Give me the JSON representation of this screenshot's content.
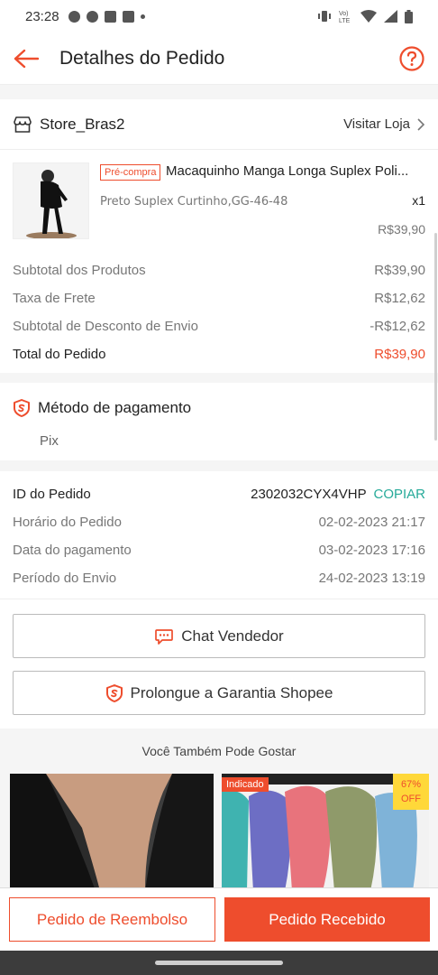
{
  "status": {
    "time": "23:28"
  },
  "header": {
    "title": "Detalhes do Pedido"
  },
  "store": {
    "name": "Store_Bras2",
    "visit_label": "Visitar Loja"
  },
  "product": {
    "badge": "Pré-compra",
    "name": "Macaquinho Manga Longa Suplex Poli...",
    "variant": "Preto Suplex Curtinho,GG-46-48",
    "qty": "x1",
    "price": "R$39,90"
  },
  "summary": [
    {
      "label": "Subtotal dos Produtos",
      "value": "R$39,90"
    },
    {
      "label": "Taxa de Frete",
      "value": "R$12,62"
    },
    {
      "label": "Subtotal de Desconto de Envio",
      "value": "-R$12,62"
    },
    {
      "label": "Total do Pedido",
      "value": "R$39,90"
    }
  ],
  "payment": {
    "title": "Método de pagamento",
    "method": "Pix"
  },
  "order_info": {
    "id_label": "ID do Pedido",
    "id_value": "2302032CYX4VHP",
    "copy_label": "COPIAR",
    "rows": [
      {
        "label": "Horário do Pedido",
        "value": "02-02-2023 21:17"
      },
      {
        "label": "Data do pagamento",
        "value": "03-02-2023 17:16"
      },
      {
        "label": "Período do Envio",
        "value": "24-02-2023 13:19"
      }
    ]
  },
  "actions": {
    "chat_label": "Chat Vendedor",
    "warranty_label": "Prolongue a Garantia Shopee"
  },
  "suggestions": {
    "title": "Você Também Pode Gostar",
    "tile2_badge": "Indicado",
    "tile2_discount_pct": "67%",
    "tile2_discount_off": "OFF"
  },
  "bottom": {
    "refund_label": "Pedido de Reembolso",
    "received_label": "Pedido Recebido"
  },
  "colors": {
    "accent": "#ee4d2d",
    "copy": "#26aa99"
  }
}
